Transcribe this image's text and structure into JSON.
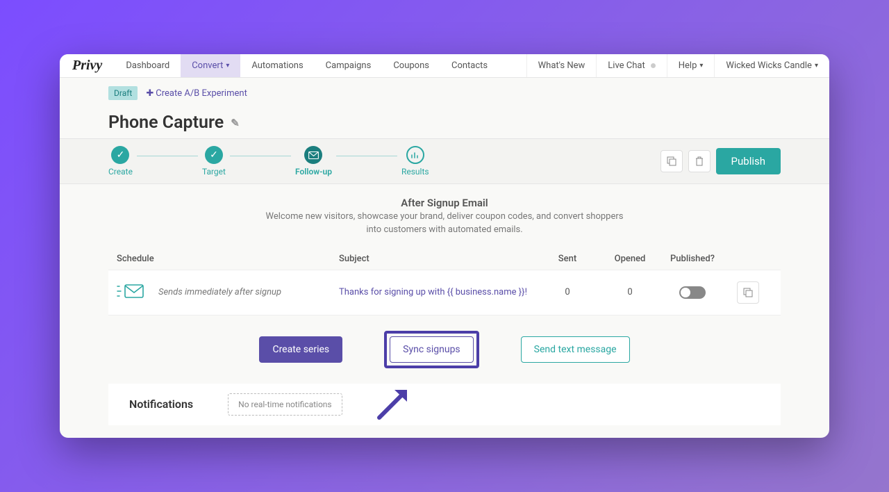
{
  "nav": {
    "logo": "Privy",
    "left": [
      "Dashboard",
      "Convert",
      "Automations",
      "Campaigns",
      "Coupons",
      "Contacts"
    ],
    "active_index": 1,
    "whats_new": "What's New",
    "live_chat": "Live Chat",
    "help": "Help",
    "account": "Wicked Wicks Candle"
  },
  "header": {
    "draft_label": "Draft",
    "ab_link": "Create A/B Experiment",
    "title": "Phone Capture"
  },
  "steps": {
    "items": [
      "Create",
      "Target",
      "Follow-up",
      "Results"
    ],
    "active_index": 2,
    "publish": "Publish"
  },
  "intro": {
    "title": "After Signup Email",
    "desc": "Welcome new visitors, showcase your brand, deliver coupon codes, and convert shoppers into customers with automated emails."
  },
  "table": {
    "headers": {
      "schedule": "Schedule",
      "subject": "Subject",
      "sent": "Sent",
      "opened": "Opened",
      "published": "Published?"
    },
    "row": {
      "schedule": "Sends immediately after signup",
      "subject": "Thanks for signing up with {{ business.name }}!",
      "sent": "0",
      "opened": "0"
    }
  },
  "buttons": {
    "create_series": "Create series",
    "sync_signups": "Sync signups",
    "send_text": "Send text message"
  },
  "notifications": {
    "title": "Notifications",
    "empty": "No real-time notifications"
  }
}
